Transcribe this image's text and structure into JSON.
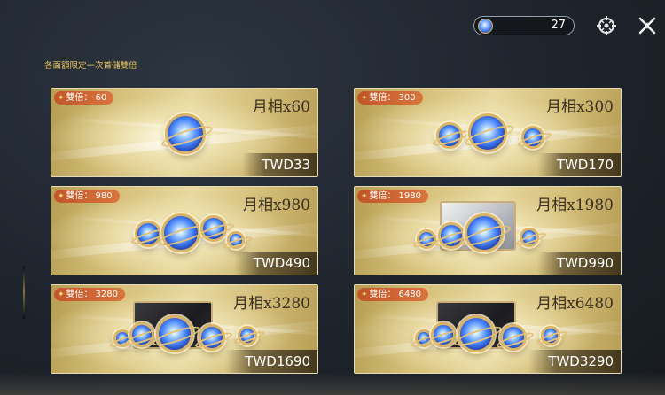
{
  "header": {
    "currency_amount": "27",
    "notice": "各面額限定一次首儲雙倍"
  },
  "icons": {
    "currency": "moon-gem-icon",
    "settings": "gear-target-icon",
    "close": "close-icon"
  },
  "colors": {
    "notice": "#e8c463",
    "badge": "#c0552a",
    "card_frame": "#e6dcb6"
  },
  "cards": [
    {
      "badge_label": "雙倍：",
      "badge_value": "60",
      "title": "月相x60",
      "price": "TWD33"
    },
    {
      "badge_label": "雙倍：",
      "badge_value": "300",
      "title": "月相x300",
      "price": "TWD170"
    },
    {
      "badge_label": "雙倍：",
      "badge_value": "980",
      "title": "月相x980",
      "price": "TWD490"
    },
    {
      "badge_label": "雙倍：",
      "badge_value": "1980",
      "title": "月相x1980",
      "price": "TWD990"
    },
    {
      "badge_label": "雙倍：",
      "badge_value": "3280",
      "title": "月相x3280",
      "price": "TWD1690"
    },
    {
      "badge_label": "雙倍：",
      "badge_value": "6480",
      "title": "月相x6480",
      "price": "TWD3290"
    }
  ]
}
